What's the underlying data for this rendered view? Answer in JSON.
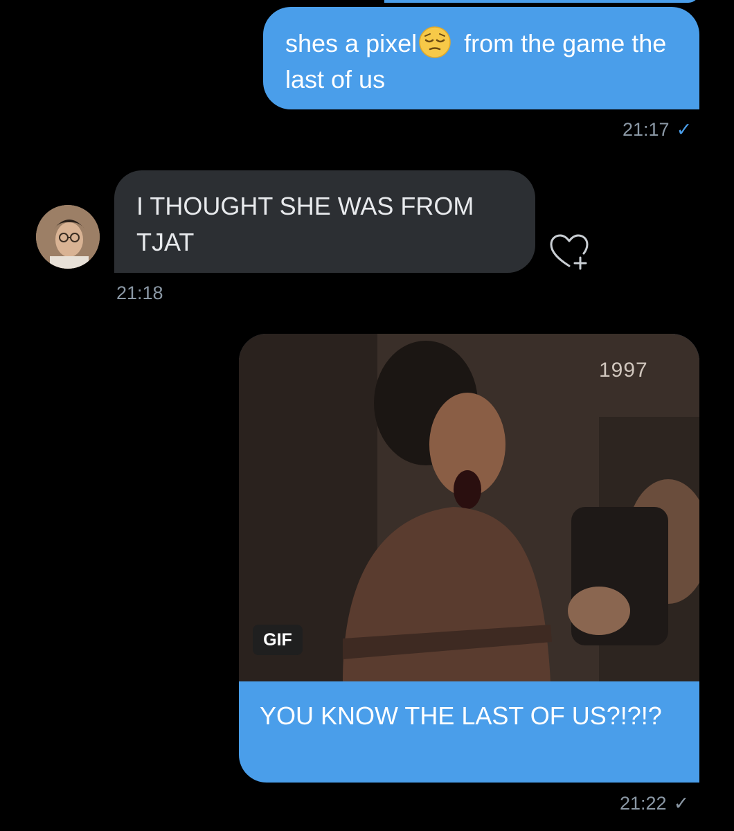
{
  "messages": [
    {
      "text_before_emoji": "shes a pixel",
      "emoji": "pensive-face",
      "text_after_emoji": "from the game the last of us",
      "time": "21:17",
      "status": "✓"
    },
    {
      "text": "I THOUGHT SHE WAS FROM TJAT",
      "time": "21:18"
    },
    {
      "gif_badge": "GIF",
      "gif_stamp": "1997",
      "text": "YOU KNOW THE LAST OF US?!?!?",
      "time": "21:22",
      "status": "✓"
    }
  ],
  "colors": {
    "background": "#000000",
    "sent_bubble": "#4a9eea",
    "received_bubble": "#2c2f33",
    "timestamp": "#8b98a5",
    "read_check": "#4a9eea"
  },
  "icons": {
    "react": "heart-plus-icon"
  }
}
